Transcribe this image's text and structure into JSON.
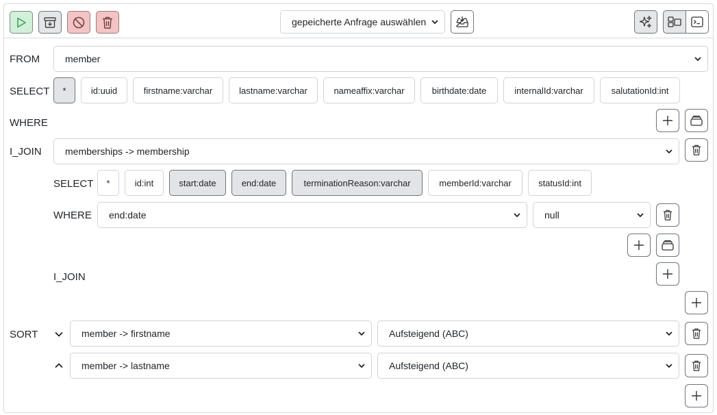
{
  "toolbar": {
    "saved_query_select": "gepeicherte Anfrage auswählen"
  },
  "labels": {
    "from": "FROM",
    "select": "SELECT",
    "where": "WHERE",
    "ijoin": "I_JOIN",
    "sort": "SORT"
  },
  "from": {
    "table": "member"
  },
  "select_columns": [
    {
      "label": "*",
      "active": true
    },
    {
      "label": "id:uuid",
      "active": false
    },
    {
      "label": "firstname:varchar",
      "active": false
    },
    {
      "label": "lastname:varchar",
      "active": false
    },
    {
      "label": "nameaffix:varchar",
      "active": false
    },
    {
      "label": "birthdate:date",
      "active": false
    },
    {
      "label": "internalId:varchar",
      "active": false
    },
    {
      "label": "salutationId:int",
      "active": false
    }
  ],
  "join": {
    "relation": "memberships -> membership",
    "select_columns": [
      {
        "label": "*",
        "active": false
      },
      {
        "label": "id:int",
        "active": false
      },
      {
        "label": "start:date",
        "active": true
      },
      {
        "label": "end:date",
        "active": true
      },
      {
        "label": "terminationReason:varchar",
        "active": true
      },
      {
        "label": "memberId:varchar",
        "active": false
      },
      {
        "label": "statusId:int",
        "active": false
      }
    ],
    "where": {
      "field": "end:date",
      "value": "null"
    }
  },
  "sort": [
    {
      "direction": "down",
      "field": "member -> firstname",
      "order": "Aufsteigend (ABC)"
    },
    {
      "direction": "up",
      "field": "member -> lastname",
      "order": "Aufsteigend (ABC)"
    }
  ]
}
